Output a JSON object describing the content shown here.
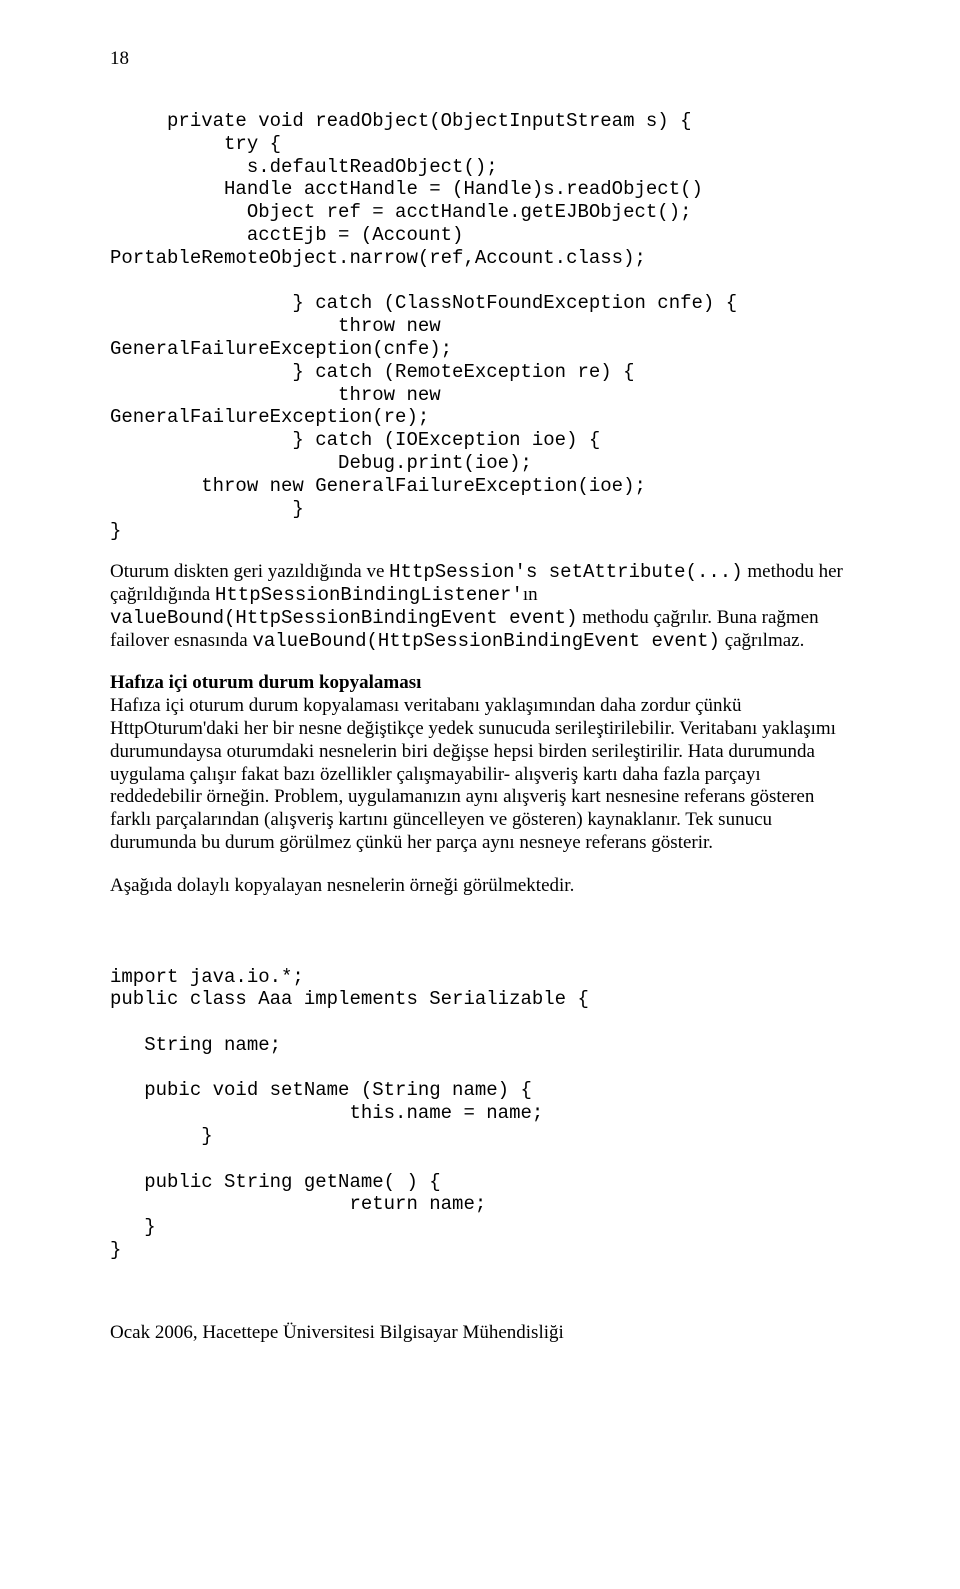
{
  "page_number": "18",
  "code_block_1": "     private void readObject(ObjectInputStream s) {\n          try {\n            s.defaultReadObject();\n          Handle acctHandle = (Handle)s.readObject()\n            Object ref = acctHandle.getEJBObject();\n            acctEjb = (Account)\nPortableRemoteObject.narrow(ref,Account.class);\n\n                } catch (ClassNotFoundException cnfe) {\n                    throw new\nGeneralFailureException(cnfe);\n                } catch (RemoteException re) {\n                    throw new\nGeneralFailureException(re);\n                } catch (IOException ioe) {\n                    Debug.print(ioe);\n        throw new GeneralFailureException(ioe);\n                }\n}",
  "para1": {
    "pre": "Oturum diskten geri yazıldığında ve ",
    "mono1": "HttpSession's setAttribute(...)",
    "mid1": " methodu her çağrıldığında ",
    "mono2": "HttpSessionBindingListener'",
    "mid2": "ın\n",
    "mono3": "valueBound(HttpSessionBindingEvent event)",
    "mid3": " methodu çağrılır. Buna rağmen failover esnasında ",
    "mono4": "valueBound(HttpSessionBindingEvent event)",
    "post": " çağrılmaz."
  },
  "heading2": "Hafıza içi oturum durum kopyalaması",
  "para2": "Hafıza içi oturum durum kopyalaması veritabanı yaklaşımından daha zordur çünkü HttpOturum'daki her bir nesne değiştikçe yedek sunucuda serileştirilebilir. Veritabanı yaklaşımı durumundaysa oturumdaki nesnelerin biri değişse hepsi birden serileştirilir. Hata durumunda uygulama çalışır fakat bazı özellikler çalışmayabilir- alışveriş kartı daha fazla parçayı reddedebilir örneğin. Problem, uygulamanızın aynı alışveriş kart nesnesine referans gösteren farklı parçalarından (alışveriş kartını güncelleyen ve gösteren) kaynaklanır. Tek sunucu durumunda bu durum görülmez çünkü her parça aynı nesneye referans gösterir.",
  "para3": "Aşağıda dolaylı kopyalayan nesnelerin örneği görülmektedir.",
  "code_block_2": "import java.io.*;\npublic class Aaa implements Serializable {\n\n   String name;\n\n   pubic void setName (String name) {\n                     this.name = name;\n        }\n\n   public String getName( ) {\n                     return name;\n   }\n}",
  "footer": "Ocak 2006, Hacettepe Üniversitesi Bilgisayar Mühendisliği"
}
